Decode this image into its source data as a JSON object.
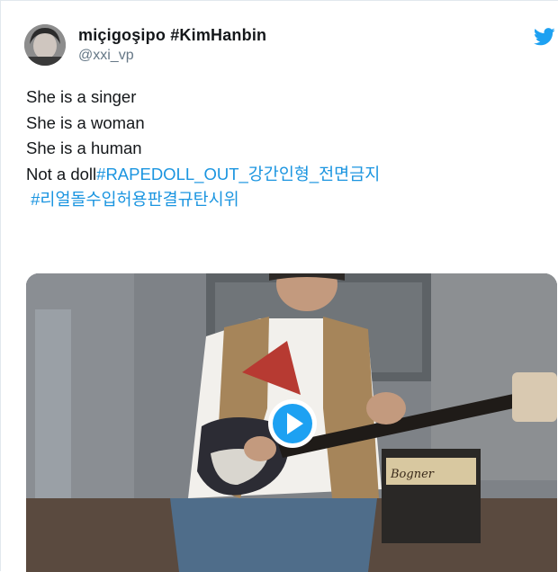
{
  "tweet": {
    "display_name": "miçigoşipo #KimHanbin",
    "handle": "@xxi_vp",
    "lines": [
      "She is a singer",
      "She is a woman",
      "She is a human"
    ],
    "line4_prefix": "Not a doll",
    "hashtag1": "#RAPEDOLL_OUT_강간인형_전면금지",
    "hashtag2": "#리얼돌수입허용판결규탄시위"
  },
  "media": {
    "amp_brand": "Bogner",
    "play_icon": "play-icon"
  },
  "colors": {
    "link": "#1b95e0",
    "twitter_blue": "#1da1f2",
    "text": "#14171a",
    "muted": "#657786"
  }
}
